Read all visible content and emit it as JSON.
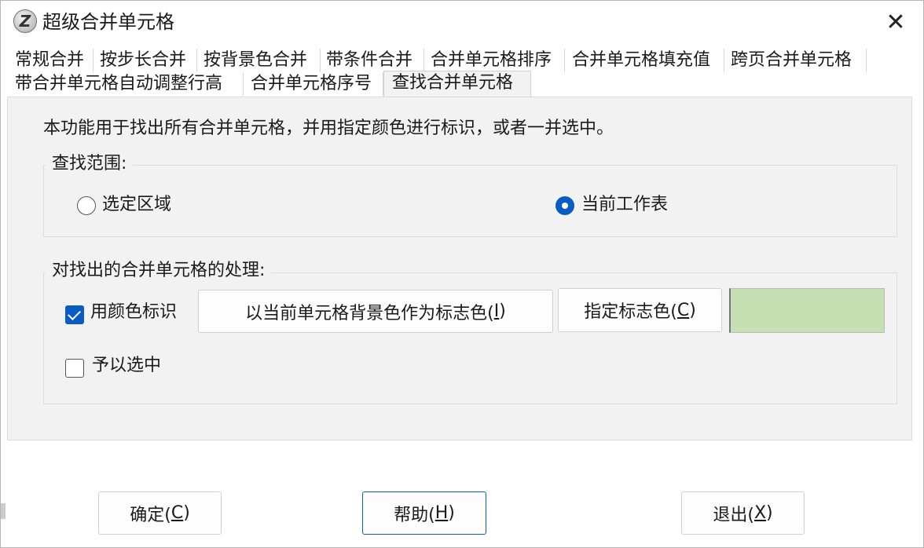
{
  "window": {
    "title": "超级合并单元格",
    "close_glyph": "✕",
    "app_icon_glyph": "Z"
  },
  "tabs": [
    {
      "label": "常规合并"
    },
    {
      "label": "按步长合并"
    },
    {
      "label": "按背景色合并"
    },
    {
      "label": "带条件合并"
    },
    {
      "label": "合并单元格排序"
    },
    {
      "label": "合并单元格填充值"
    },
    {
      "label": "跨页合并单元格"
    },
    {
      "label": "带合并单元格自动调整行高"
    },
    {
      "label": "合并单元格序号"
    },
    {
      "label": "查找合并单元格"
    }
  ],
  "active_tab": "查找合并单元格",
  "description": "本功能用于找出所有合并单元格，并用指定颜色进行标识，或者一并选中。",
  "range_group": {
    "label": "查找范围:",
    "options": [
      {
        "label": "选定区域",
        "checked": false
      },
      {
        "label": "当前工作表",
        "checked": true
      }
    ]
  },
  "process_group": {
    "label": "对找出的合并单元格的处理:",
    "mark_color": {
      "label": "用颜色标识",
      "checked": true
    },
    "select": {
      "label": "予以选中",
      "checked": false
    },
    "use_bg_button": {
      "text": "以当前单元格背景色作为标志色(",
      "key": "I",
      "suffix": ")"
    },
    "specify_button": {
      "text": "指定标志色(",
      "key": "C",
      "suffix": ")"
    },
    "swatch_color": "#c6e0b4"
  },
  "footer": {
    "ok_button": {
      "text": "确定(",
      "key": "C",
      "suffix": ")"
    },
    "help_button": {
      "text": "帮助(",
      "key": "H",
      "suffix": ")"
    },
    "exit_button": {
      "text": "退出(",
      "key": "X",
      "suffix": ")"
    }
  },
  "colors": {
    "accent": "#0a5cc2",
    "panel_bg": "#f2f2f2"
  }
}
